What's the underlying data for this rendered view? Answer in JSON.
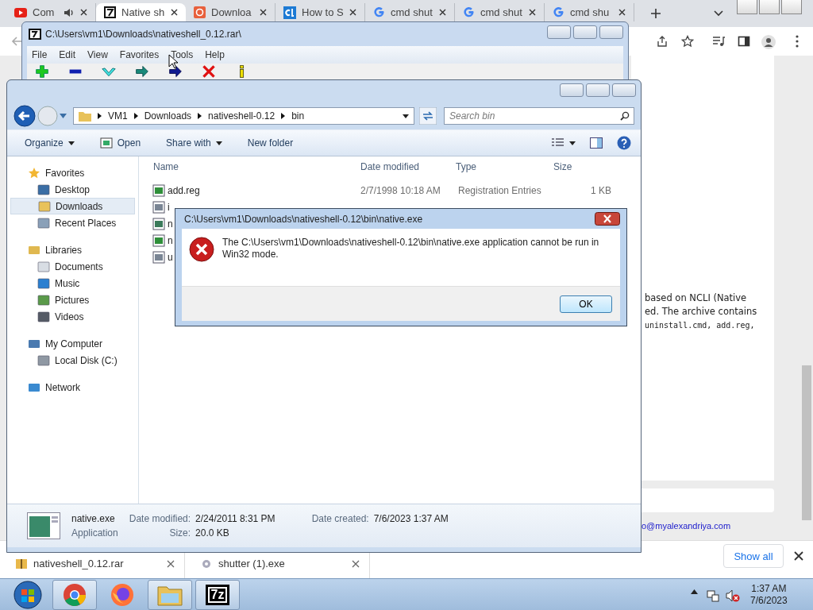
{
  "browser": {
    "tabs": [
      {
        "label": "Com",
        "kind": "youtube",
        "audio": true,
        "selected": false
      },
      {
        "label": "Native sh",
        "kind": "sevenzip",
        "audio": false,
        "selected": true
      },
      {
        "label": "Downloa",
        "kind": "at",
        "audio": false,
        "selected": false
      },
      {
        "label": "How to S",
        "kind": "ct",
        "audio": false,
        "selected": false
      },
      {
        "label": "cmd shut",
        "kind": "google",
        "audio": false,
        "selected": false
      },
      {
        "label": "cmd shut",
        "kind": "google",
        "audio": false,
        "selected": false
      },
      {
        "label": "cmd shu",
        "kind": "google",
        "audio": false,
        "selected": false
      }
    ],
    "page_lines": [
      {
        "text": "based on NCLI (Native",
        "kind": "prose"
      },
      {
        "text": "ed. The archive contains",
        "kind": "prose"
      },
      {
        "text": "uninstall.cmd, add.reg,",
        "kind": "code"
      }
    ],
    "email": "o@myalexandriya.com",
    "downloads": [
      {
        "name": "nativeshell_0.12.rar",
        "kind": "archive"
      },
      {
        "name": "shutter (1).exe",
        "kind": "exe"
      }
    ],
    "show_all": "Show all"
  },
  "sevenzip": {
    "title": "C:\\Users\\vm1\\Downloads\\nativeshell_0.12.rar\\",
    "menu": [
      "File",
      "Edit",
      "View",
      "Favorites",
      "Tools",
      "Help"
    ]
  },
  "explorer": {
    "breadcrumb": [
      "VM1",
      "Downloads",
      "nativeshell-0.12",
      "bin"
    ],
    "search": {
      "placeholder": "Search bin"
    },
    "commands": [
      {
        "label": "Organize",
        "kind": "menu"
      },
      {
        "label": "Open",
        "kind": "open"
      },
      {
        "label": "Share with",
        "kind": "menu"
      },
      {
        "label": "New folder",
        "kind": "plain"
      }
    ],
    "sidebar": [
      {
        "label": "Favorites",
        "kind": "star",
        "selected": false,
        "children": [
          {
            "label": "Desktop",
            "kind": "desktop",
            "selected": false
          },
          {
            "label": "Downloads",
            "kind": "folder",
            "selected": true
          },
          {
            "label": "Recent Places",
            "kind": "recent",
            "selected": false
          }
        ]
      },
      {
        "label": "Libraries",
        "kind": "library",
        "selected": false,
        "children": [
          {
            "label": "Documents",
            "kind": "document",
            "selected": false
          },
          {
            "label": "Music",
            "kind": "music",
            "selected": false
          },
          {
            "label": "Pictures",
            "kind": "pictures",
            "selected": false
          },
          {
            "label": "Videos",
            "kind": "videos",
            "selected": false
          }
        ]
      },
      {
        "label": "My Computer",
        "kind": "computer",
        "selected": false,
        "children": [
          {
            "label": "Local Disk (C:)",
            "kind": "disk",
            "selected": false
          }
        ]
      },
      {
        "label": "Network",
        "kind": "network",
        "selected": false
      }
    ],
    "columns": [
      "Name",
      "Date modified",
      "Type",
      "Size"
    ],
    "files": [
      {
        "name": "add.reg",
        "date": "2/7/1998 10:18 AM",
        "type": "Registration Entries",
        "size": "1 KB",
        "kind": "reg"
      },
      {
        "name": "i",
        "kind": "cmd"
      },
      {
        "name": "n",
        "kind": "exe"
      },
      {
        "name": "n",
        "kind": "reg"
      },
      {
        "name": "u",
        "kind": "cmd"
      }
    ],
    "details": {
      "name": "native.exe",
      "kind": "Application",
      "modified_label": "Date modified:",
      "modified": "2/24/2011 8:31 PM",
      "size_label": "Size:",
      "size": "20.0 KB",
      "created_label": "Date created:",
      "created": "7/6/2023 1:37 AM"
    }
  },
  "dialog": {
    "title": "C:\\Users\\vm1\\Downloads\\nativeshell-0.12\\bin\\native.exe",
    "message": "The C:\\Users\\vm1\\Downloads\\nativeshell-0.12\\bin\\native.exe application cannot be run in Win32 mode.",
    "button": "OK"
  },
  "taskbar": {
    "apps": [
      {
        "kind": "chrome",
        "running": true
      },
      {
        "kind": "firefox",
        "running": false
      },
      {
        "kind": "explorer",
        "running": true
      },
      {
        "kind": "sevenzip",
        "text": "7z",
        "running": true
      }
    ],
    "time": "1:37 AM",
    "date": "7/6/2023"
  }
}
